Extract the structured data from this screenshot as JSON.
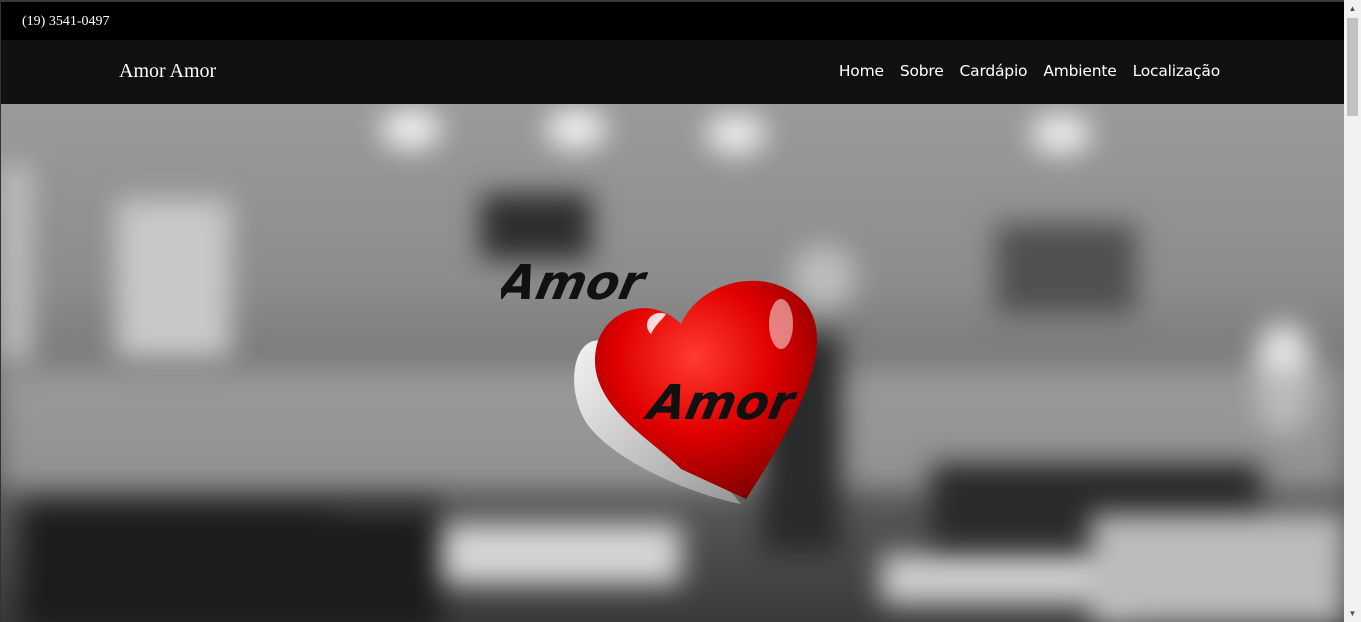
{
  "topbar": {
    "phone": "(19) 3541-0497"
  },
  "navbar": {
    "brand": "Amor Amor",
    "links": [
      "Home",
      "Sobre",
      "Cardápio",
      "Ambiente",
      "Localização"
    ]
  },
  "hero": {
    "logo_text_top": "Amor",
    "logo_text_bottom": "Amor",
    "logo_icon": "heart-icon",
    "accent_color": "#e00000"
  },
  "scrollbar": {
    "up_icon": "triangle-up-icon",
    "down_icon": "triangle-down-icon"
  }
}
